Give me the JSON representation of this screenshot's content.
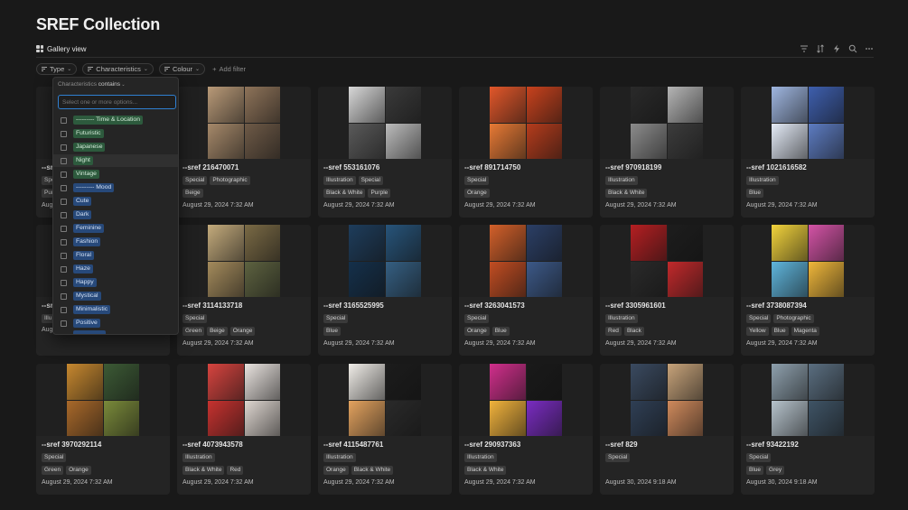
{
  "page": {
    "title": "SREF Collection"
  },
  "view": {
    "label": "Gallery view"
  },
  "filters": [
    {
      "label": "Type"
    },
    {
      "label": "Characteristics"
    },
    {
      "label": "Colour"
    }
  ],
  "add_filter": {
    "label": "Add filter"
  },
  "dropdown": {
    "property": "Characteristics",
    "operator": "contains",
    "search_placeholder": "Select one or more options...",
    "options": [
      {
        "label": "--------- Time & Location",
        "color": "#2d5a3d",
        "text": "#d2ead8"
      },
      {
        "label": "Futuristic",
        "color": "#2d5a3d",
        "text": "#d2ead8"
      },
      {
        "label": "Japanese",
        "color": "#2d5a3d",
        "text": "#d2ead8"
      },
      {
        "label": "Night",
        "color": "#2d5a3d",
        "text": "#d2ead8"
      },
      {
        "label": "Vintage",
        "color": "#2d5a3d",
        "text": "#d2ead8"
      },
      {
        "label": "--------- Mood",
        "color": "#27497a",
        "text": "#d3e1f5"
      },
      {
        "label": "Cute",
        "color": "#27497a",
        "text": "#d3e1f5"
      },
      {
        "label": "Dark",
        "color": "#27497a",
        "text": "#d3e1f5"
      },
      {
        "label": "Feminine",
        "color": "#27497a",
        "text": "#d3e1f5"
      },
      {
        "label": "Fashion",
        "color": "#27497a",
        "text": "#d3e1f5"
      },
      {
        "label": "Floral",
        "color": "#27497a",
        "text": "#d3e1f5"
      },
      {
        "label": "Haze",
        "color": "#27497a",
        "text": "#d3e1f5"
      },
      {
        "label": "Happy",
        "color": "#27497a",
        "text": "#d3e1f5"
      },
      {
        "label": "Mystical",
        "color": "#27497a",
        "text": "#d3e1f5"
      },
      {
        "label": "Minimalistic",
        "color": "#27497a",
        "text": "#d3e1f5"
      },
      {
        "label": "Positive",
        "color": "#27497a",
        "text": "#d3e1f5"
      }
    ]
  },
  "cards": [
    {
      "name": "--sref 216470071",
      "tags": [
        "Special",
        "Photographic"
      ],
      "tags2": [
        "Beige"
      ],
      "date": "August 29, 2024 7:32 AM",
      "colors": [
        "#b99a78",
        "#8e7359",
        "#a6896a",
        "#6e5a47"
      ]
    },
    {
      "name": "--sref 553161076",
      "tags": [
        "Illustration",
        "Special"
      ],
      "tags2": [
        "Black & White",
        "Purple"
      ],
      "date": "August 29, 2024 7:32 AM",
      "colors": [
        "#d8d8d8",
        "#3a3a3a",
        "#5a5a5a",
        "#bcbcbc"
      ]
    },
    {
      "name": "--sref 891714750",
      "tags": [
        "Special"
      ],
      "tags2": [
        "Orange"
      ],
      "date": "August 29, 2024 7:32 AM",
      "colors": [
        "#e2572a",
        "#c8421d",
        "#e87a35",
        "#b53c1c"
      ]
    },
    {
      "name": "--sref 970918199",
      "tags": [
        "Illustration"
      ],
      "tags2": [
        "Black & White"
      ],
      "date": "August 29, 2024 7:32 AM",
      "colors": [
        "#2a2a2a",
        "#b5b5b5",
        "#8c8c8c",
        "#3c3c3c"
      ]
    },
    {
      "name": "--sref 1021616582",
      "tags": [
        "Illustration"
      ],
      "tags2": [
        "Blue"
      ],
      "date": "August 29, 2024 7:32 AM",
      "colors": [
        "#9fb6e0",
        "#3e5fae",
        "#e4ebf7",
        "#5d7cc2"
      ]
    },
    {
      "name": "--sref 3114133718",
      "tags": [
        "Special"
      ],
      "tags2": [
        "Green",
        "Beige",
        "Orange"
      ],
      "date": "August 29, 2024 7:32 AM",
      "colors": [
        "#c4ab7c",
        "#7a6a45",
        "#a48b5c",
        "#5d6240"
      ]
    },
    {
      "name": "--sref 3165525995",
      "tags": [
        "Special"
      ],
      "tags2": [
        "Blue"
      ],
      "date": "August 29, 2024 7:32 AM",
      "colors": [
        "#1e3d5c",
        "#27547a",
        "#14304b",
        "#355f82"
      ]
    },
    {
      "name": "--sref 3263041573",
      "tags": [
        "Special"
      ],
      "tags2": [
        "Orange",
        "Blue"
      ],
      "date": "August 29, 2024 7:32 AM",
      "colors": [
        "#d3602a",
        "#2b3f66",
        "#c24d22",
        "#3c5988"
      ]
    },
    {
      "name": "--sref 3305961601",
      "tags": [
        "Illustration"
      ],
      "tags2": [
        "Red",
        "Black"
      ],
      "date": "August 29, 2024 7:32 AM",
      "colors": [
        "#b51f22",
        "#1d1d1d",
        "#2a2a2a",
        "#c2292b"
      ]
    },
    {
      "name": "--sref 3738087394",
      "tags": [
        "Special",
        "Photographic"
      ],
      "tags2": [
        "Yellow",
        "Blue",
        "Magenta"
      ],
      "date": "August 29, 2024 7:32 AM",
      "colors": [
        "#f2d33c",
        "#d453a6",
        "#5fb5dc",
        "#f0b73a"
      ]
    },
    {
      "name": "--sref 3970292114",
      "tags": [
        "Special"
      ],
      "tags2": [
        "Green",
        "Orange"
      ],
      "date": "August 29, 2024 7:32 AM",
      "colors": [
        "#c7882f",
        "#3c5a35",
        "#a9692a",
        "#7a8a3a"
      ]
    },
    {
      "name": "--sref 4073943578",
      "tags": [
        "Illustration"
      ],
      "tags2": [
        "Black & White",
        "Red"
      ],
      "date": "August 29, 2024 7:32 AM",
      "colors": [
        "#d7443f",
        "#e9e3df",
        "#c7322f",
        "#ded6d0"
      ]
    },
    {
      "name": "--sref 4115487761",
      "tags": [
        "Illustration"
      ],
      "tags2": [
        "Orange",
        "Black & White"
      ],
      "date": "August 29, 2024 7:32 AM",
      "colors": [
        "#f0ede8",
        "#1c1c1c",
        "#e4a35f",
        "#2a2a2a"
      ]
    },
    {
      "name": "--sref 290937363",
      "tags": [
        "Illustration"
      ],
      "tags2": [
        "Black & White"
      ],
      "date": "August 29, 2024 7:32 AM",
      "colors": [
        "#d12f8c",
        "#1a1a1a",
        "#f2b33c",
        "#7a2cc2"
      ]
    },
    {
      "name": "--sref 829",
      "tags": [
        "Special"
      ],
      "tags2": [],
      "date": "August 30, 2024 9:18 AM",
      "colors": [
        "#3a4a60",
        "#c7a37a",
        "#2f3f55",
        "#d08a5c"
      ]
    },
    {
      "name": "--sref 93422192",
      "tags": [
        "Special"
      ],
      "tags2": [
        "Blue",
        "Grey"
      ],
      "date": "August 30, 2024 9:18 AM",
      "colors": [
        "#8ea0ad",
        "#5a6e80",
        "#b6c3cc",
        "#3f5466"
      ]
    }
  ],
  "hidden_cards": [
    {
      "name_prefix": "--sr",
      "tags": [
        "Spec"
      ],
      "tags2": [
        "Pur"
      ],
      "date_prefix": "Aug"
    },
    {
      "name_prefix": "--sr",
      "tags": [
        "Illu"
      ],
      "tags2": [],
      "date_prefix": "Aug"
    }
  ]
}
